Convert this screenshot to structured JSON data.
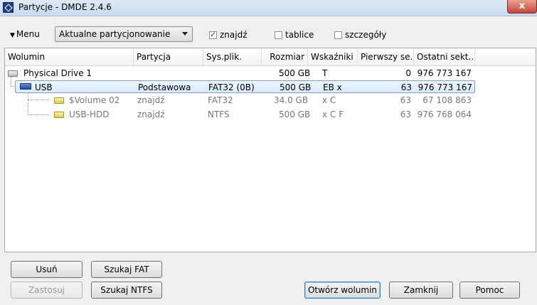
{
  "window": {
    "title": "Partycje - DMDE 2.4.6",
    "close": "x"
  },
  "toolbar": {
    "menu_label": "Menu",
    "mode_selected": "Aktualne partycjonowanie",
    "checkbox_find": {
      "label": "znajdź",
      "checked": true
    },
    "checkbox_tables": {
      "label": "tablice",
      "checked": false
    },
    "checkbox_details": {
      "label": "szczegóły",
      "checked": false
    }
  },
  "table": {
    "columns": [
      "Wolumin",
      "Partycja",
      "Sys.plik.",
      "Rozmiar",
      "Wskaźniki",
      "Pierwszy se...",
      "Ostatni sekt..."
    ],
    "rows": [
      {
        "volume": "Physical Drive 1",
        "partition": "",
        "fs": "",
        "size": "500 GB",
        "flags": "T",
        "first": "0",
        "last": "976 773 167",
        "icon": "physical-drive-icon",
        "style": "normal"
      },
      {
        "volume": "USB",
        "partition": "Podstawowa",
        "fs": "FAT32 (0B)",
        "size": "500 GB",
        "flags": "EB x",
        "first": "63",
        "last": "976 773 167",
        "icon": "usb-drive-icon",
        "style": "selected"
      },
      {
        "volume": "$Volume 02",
        "partition": "znajdź",
        "fs": "FAT32",
        "size": "34.0 GB",
        "flags": "x C",
        "first": "63",
        "last": "67 108 863",
        "icon": "volume-icon",
        "style": "grey"
      },
      {
        "volume": "USB-HDD",
        "partition": "znajdź",
        "fs": "NTFS",
        "size": "500 GB",
        "flags": "x C F",
        "first": "63",
        "last": "976 768 064",
        "icon": "volume-icon",
        "style": "grey"
      }
    ]
  },
  "buttons": {
    "delete": "Usuń",
    "search_fat": "Szukaj FAT",
    "apply": "Zastosuj",
    "search_ntfs": "Szukaj NTFS",
    "open_volume": "Otwórz wolumin",
    "close": "Zamknij",
    "help": "Pomoc"
  }
}
